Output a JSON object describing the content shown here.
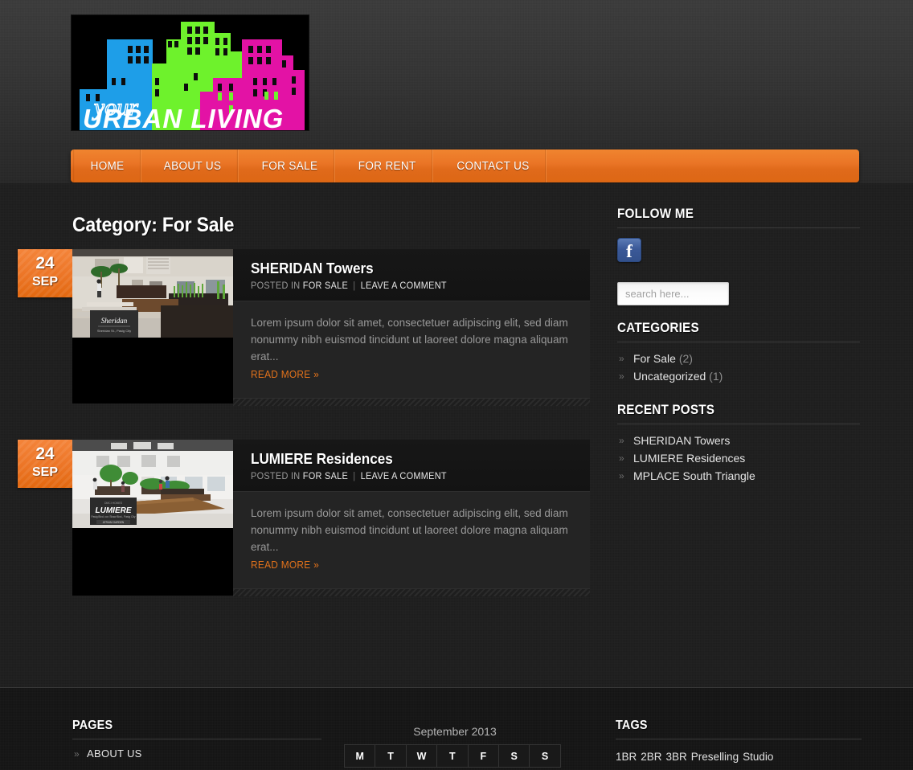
{
  "site": {
    "logo_script_text": "your",
    "logo_main_text": "URBAN LIVING"
  },
  "nav": {
    "items": [
      {
        "label": "HOME"
      },
      {
        "label": "ABOUT US"
      },
      {
        "label": "FOR SALE"
      },
      {
        "label": "FOR RENT"
      },
      {
        "label": "CONTACT US"
      }
    ]
  },
  "main": {
    "page_title": "Category: For Sale",
    "posts": [
      {
        "day": "24",
        "month": "SEP",
        "title": "SHERIDAN Towers",
        "posted_in_label": "POSTED IN",
        "category": "FOR SALE",
        "separator": "|",
        "comments": "LEAVE A COMMENT",
        "excerpt": "Lorem ipsum dolor sit amet, consectetuer adipiscing elit, sed diam nonummy nibh euismod tincidunt ut laoreet dolore magna aliquam erat...",
        "read_more": "READ MORE »",
        "thumb_caption": "Sheridan"
      },
      {
        "day": "24",
        "month": "SEP",
        "title": "LUMIERE Residences",
        "posted_in_label": "POSTED IN",
        "category": "FOR SALE",
        "separator": "|",
        "comments": "LEAVE A COMMENT",
        "excerpt": "Lorem ipsum dolor sit amet, consectetuer adipiscing elit, sed diam nonummy nibh euismod tincidunt ut laoreet dolore magna aliquam erat...",
        "read_more": "READ MORE »",
        "thumb_caption": "LUMIERE"
      }
    ]
  },
  "sidebar": {
    "follow": {
      "title": "FOLLOW ME",
      "facebook_glyph": "f"
    },
    "search": {
      "placeholder": "search here...",
      "value": ""
    },
    "categories": {
      "title": "CATEGORIES",
      "items": [
        {
          "label": "For Sale",
          "count": "(2)"
        },
        {
          "label": "Uncategorized",
          "count": "(1)"
        }
      ]
    },
    "recent_posts": {
      "title": "RECENT POSTS",
      "items": [
        {
          "label": "SHERIDAN Towers"
        },
        {
          "label": "LUMIERE Residences"
        },
        {
          "label": "MPLACE South Triangle"
        }
      ]
    }
  },
  "footer": {
    "pages": {
      "title": "PAGES",
      "items": [
        {
          "label": "ABOUT US"
        }
      ]
    },
    "calendar": {
      "caption": "September 2013",
      "weekdays": [
        "M",
        "T",
        "W",
        "T",
        "F",
        "S",
        "S"
      ]
    },
    "tags": {
      "title": "TAGS",
      "items": [
        "1BR",
        "2BR",
        "3BR",
        "Preselling",
        "Studio"
      ]
    }
  },
  "colors": {
    "accent_orange": "#e2721b",
    "nav_orange": "#ea7526",
    "facebook_blue": "#3b5998",
    "body_bg": "#1d1d1d"
  }
}
